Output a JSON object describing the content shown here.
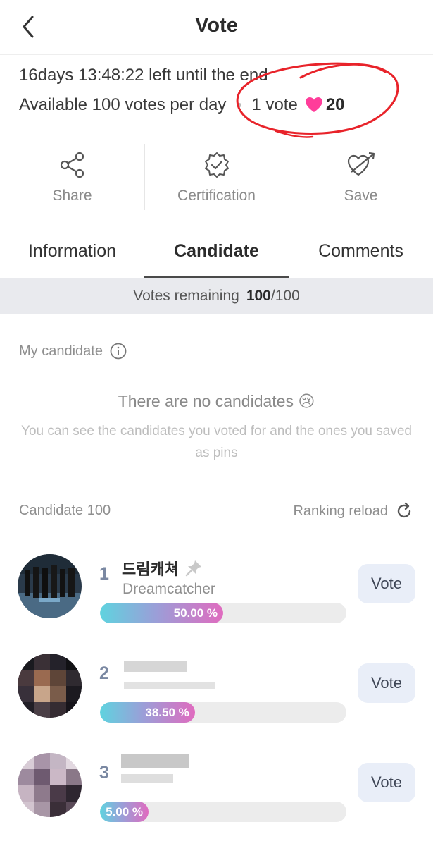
{
  "header": {
    "title": "Vote"
  },
  "info": {
    "countdown": "16days 13:48:22 left until the end",
    "available": "Available 100 votes per day",
    "vote_unit": "1 vote",
    "heart_count": "20",
    "heart_color": "#ff3d9a"
  },
  "actions": [
    {
      "label": "Share",
      "icon": "share-icon"
    },
    {
      "label": "Certification",
      "icon": "badge-check-icon"
    },
    {
      "label": "Save",
      "icon": "heart-arrow-icon"
    }
  ],
  "tabs": [
    {
      "label": "Information",
      "active": false
    },
    {
      "label": "Candidate",
      "active": true
    },
    {
      "label": "Comments",
      "active": false
    }
  ],
  "votes_remaining": {
    "label": "Votes remaining",
    "value": "100",
    "total": "/100"
  },
  "my_candidate": {
    "label": "My candidate",
    "empty_title": "There are no candidates 😢",
    "empty_subtitle": "You can see the candidates you voted for and the ones you saved as pins"
  },
  "candidates_header": {
    "label": "Candidate 100",
    "reload": "Ranking reload"
  },
  "candidates": [
    {
      "rank": "1",
      "name": "드림캐쳐",
      "subtitle": "Dreamcatcher",
      "percent": 50.0,
      "percent_label": "50.00 %",
      "vote_label": "Vote"
    },
    {
      "rank": "2",
      "name": "",
      "subtitle": "",
      "percent": 38.5,
      "percent_label": "38.50 %",
      "vote_label": "Vote"
    },
    {
      "rank": "3",
      "name": "",
      "subtitle": "",
      "percent": 5.0,
      "percent_label": "5.00 %",
      "vote_label": "Vote"
    }
  ]
}
